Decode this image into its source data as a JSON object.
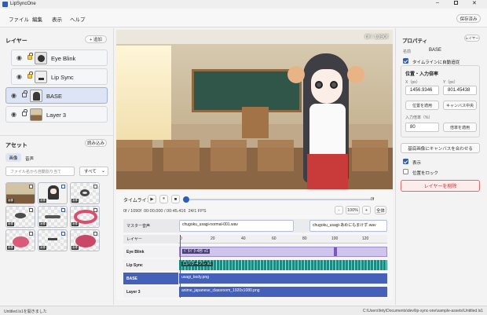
{
  "app": {
    "title": "LipSyncOne",
    "save_label": "保存済み"
  },
  "menu": [
    "ファイル",
    "編集",
    "表示",
    "ヘルプ"
  ],
  "layers_panel": {
    "title": "レイヤー",
    "add_label": "+ 追加",
    "items": [
      {
        "name": "Eye Blink",
        "locked": true,
        "selected": false
      },
      {
        "name": "Lip Sync",
        "locked": true,
        "selected": false
      },
      {
        "name": "BASE",
        "locked": false,
        "selected": true
      },
      {
        "name": "Layer 3",
        "locked": false,
        "selected": false
      }
    ]
  },
  "assets_panel": {
    "title": "アセット",
    "load_label": "読み込み",
    "tabs": [
      "画像",
      "音声"
    ],
    "search_placeholder": "ファイル名から自動割り当て",
    "filter_value": "すべて",
    "items": [
      {
        "tag": "画像",
        "label": "教室"
      },
      {
        "tag": "画像",
        "label": "BASE"
      },
      {
        "tag": "画像",
        "label": ""
      },
      {
        "tag": "画像",
        "label": ""
      },
      {
        "tag": "画像",
        "label": ""
      },
      {
        "tag": "画像",
        "label": ""
      },
      {
        "tag": "画像",
        "label": ""
      },
      {
        "tag": "画像",
        "label": ""
      },
      {
        "tag": "画像",
        "label": ""
      }
    ]
  },
  "preview": {
    "frame_counter": "0f / 1090f"
  },
  "timeline": {
    "title": "タイムライン",
    "slider_end": "0f",
    "status": "0f / 1090f  00:00.000 / 00:45.416  24/1 FPS",
    "zoom_out": "-",
    "zoom": "100%",
    "zoom_in": "+",
    "fit": "全体",
    "master_label": "マスター音声",
    "audio_clips": [
      "chugoku_usagi-normal-001.wav",
      "chugoku_usagi-あめにもまけず.wav"
    ],
    "layer_header": "レイヤー",
    "ruler": [
      "0",
      "20",
      "40",
      "60",
      "80",
      "100",
      "120"
    ],
    "tracks": [
      {
        "name": "Eye Blink",
        "clip": "ﾊﾟﾀﾊﾟﾀ-4秒 x1",
        "color": "#cfc4ea"
      },
      {
        "name": "Lip Sync",
        "clip": "口パク-4フレ x1",
        "color": "#1c8a80"
      },
      {
        "name": "BASE",
        "clip": "usagi_body.png",
        "color": "#4560b8"
      },
      {
        "name": "Layer 3",
        "clip": "anime_japanese_classroom_1920x1080.png",
        "color": "#4560b8"
      }
    ]
  },
  "properties": {
    "title": "プロパティ",
    "badge": "レイヤー",
    "name_label": "名前",
    "name_value": "BASE",
    "auto_follow": "タイムラインに自動追従",
    "pos_section": "位置・入力倍率",
    "x_label": "X（px）",
    "y_label": "Y（px）",
    "x_value": "1456.9346",
    "y_value": "801.45438",
    "apply_pos": "位置を適用",
    "center": "キャンバス中央",
    "scale_label": "入力倍率（%）",
    "scale_value": "80",
    "apply_scale": "倍率を適用",
    "fit_base": "基底画像にキャンバスを合わせる",
    "visible": "表示",
    "lock": "位置をロック",
    "delete": "レイヤーを削除"
  },
  "statusbar": {
    "left": "Untitled.ls1を開きました",
    "right": "C:\\Users\\fety\\Documents\\dev\\lip-sync-one\\sample-assets\\Untitled.ls1"
  }
}
